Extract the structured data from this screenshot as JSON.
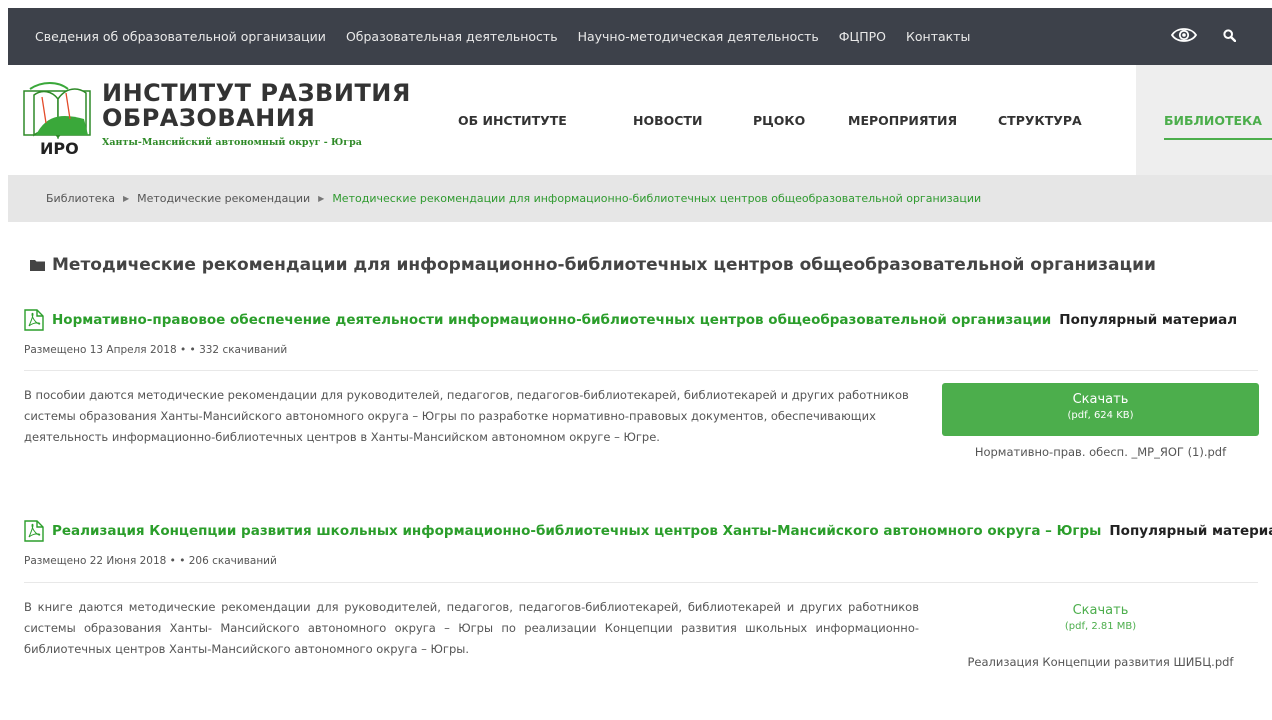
{
  "top_nav": {
    "links": [
      "Сведения об образовательной организации",
      "Образовательная деятельность",
      "Научно-методическая деятельность",
      "ФЦПРО",
      "Контакты"
    ],
    "icons": [
      "eye-icon",
      "search-icon"
    ]
  },
  "logo": {
    "title_line1": "ИНСТИТУТ РАЗВИТИЯ",
    "title_line2": "ОБРАЗОВАНИЯ",
    "subtitle": "Ханты-Мансийский автономный округ - Югра",
    "abbr": "ИРО"
  },
  "main_nav": {
    "items": [
      "ОБ ИНСТИТУТЕ",
      "НОВОСТИ",
      "РЦОКО",
      "МЕРОПРИЯТИЯ",
      "СТРУКТУРА"
    ],
    "active": "БИБЛИОТЕКА"
  },
  "breadcrumb": {
    "items": [
      "Библиотека",
      "Методические рекомендации"
    ],
    "current": "Методические рекомендации для информационно-библиотечных центров общеобразовательной организации"
  },
  "category": {
    "title": "Методические рекомендации для информационно-библиотечных центров общеобразовательной организации"
  },
  "documents": [
    {
      "title": "Нормативно-правовое обеспечение деятельности информационно-библиотечных центров общеобразовательной организации",
      "badge": "Популярный материал",
      "meta": "Размещено 13 Апреля 2018 •  • 332 скачиваний",
      "description": "В пособии даются методические рекомендации для руководителей, педагогов, педагогов-библиотекарей, библиотекарей и других работников системы образования Ханты-Мансийского автономного округа – Югры по разработке нормативно-правовых документов, обеспечивающих деятельность информационно-библиотечных центров в Ханты-Мансийском автономном округе – Югре.",
      "download_label": "Скачать",
      "download_info": "(pdf, 624 KB)",
      "filename": "Нормативно-прав. обесп. _МР_ЯОГ (1).pdf"
    },
    {
      "title": "Реализация Концепции развития школьных информационно-библиотечных центров Ханты-Мансийского автономного округа – Югры",
      "badge": "Популярный материал",
      "meta": "Размещено 22 Июня 2018 •  • 206 скачиваний",
      "description": "В книге даются методические рекомендации для руководителей, педагогов, педагогов-библиотекарей, библиотекарей и других работников системы образования Ханты- Мансийского автономного округа – Югры по реализации Концепции развития школьных информационно-библиотечных центров Ханты-Мансийского автономного округа – Югры.",
      "download_label": "Скачать",
      "download_info": "(pdf, 2.81 MB)",
      "filename": "Реализация Концепции развития ШИБЦ.pdf"
    }
  ],
  "colors": {
    "topnav_bg": "#3d414a",
    "accent_green": "#4cae4c",
    "link_green": "#2b9e2b",
    "breadcrumb_bg": "#e6e6e6"
  }
}
